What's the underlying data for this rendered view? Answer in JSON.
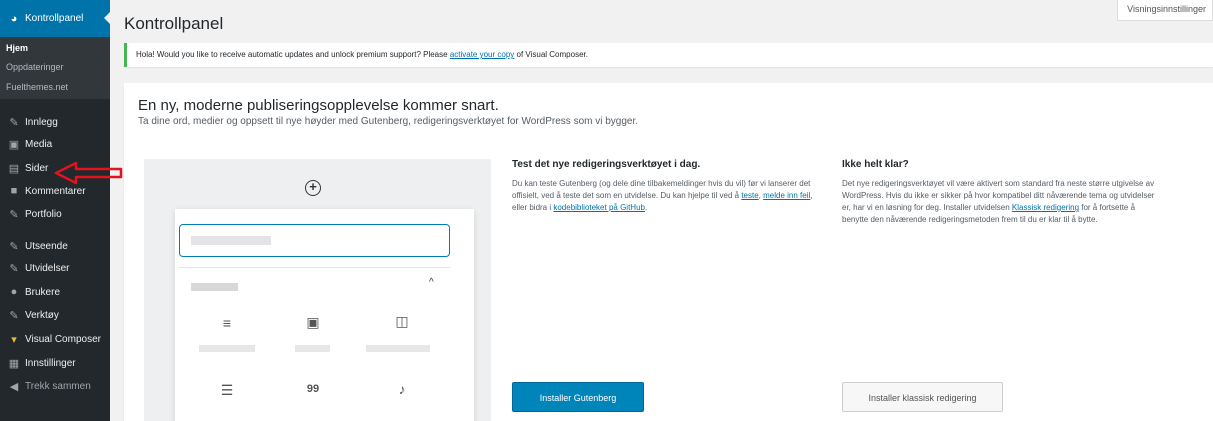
{
  "sidebar": {
    "dashboard": "Kontrollpanel",
    "sub_items": [
      "Hjem",
      "Oppdateringer",
      "Fuelthemes.net"
    ],
    "items": [
      {
        "label": "Innlegg",
        "icon": "✎"
      },
      {
        "label": "Media",
        "icon": "▣"
      },
      {
        "label": "Sider",
        "icon": "▤"
      },
      {
        "label": "Kommentarer",
        "icon": "■"
      },
      {
        "label": "Portfolio",
        "icon": "✎"
      },
      {
        "label": "Utseende",
        "icon": "✎"
      },
      {
        "label": "Utvidelser",
        "icon": "✎"
      },
      {
        "label": "Brukere",
        "icon": "●"
      },
      {
        "label": "Verktøy",
        "icon": "✎"
      },
      {
        "label": "Visual Composer",
        "icon": "▾"
      },
      {
        "label": "Innstillinger",
        "icon": "▦"
      }
    ],
    "collapse": "Trekk sammen",
    "dashboard_icon": "◕",
    "collapse_icon": "◀"
  },
  "header": {
    "title": "Kontrollpanel",
    "screen_options": "Visningsinnstillinger"
  },
  "notice": {
    "text_before": "Hola! Would you like to receive automatic updates and unlock premium support? Please ",
    "link": "activate your copy",
    "text_after": " of Visual Composer."
  },
  "welcome": {
    "title": "En ny, moderne publiseringsopplevelse kommer snart.",
    "subtitle": "Ta dine ord, medier og oppsett til nye høyder med Gutenberg, redigeringsverktøyet for WordPress som vi bygger.",
    "mockup_icons": {
      "add": "+",
      "chevron": "^",
      "paragraph": "≡",
      "image": "▣",
      "gallery": "◫",
      "list": "☰",
      "quote": "99",
      "audio": "♪"
    },
    "test": {
      "title": "Test det nye redigeringsverktøyet i dag.",
      "text": "Du kan teste Gutenberg (og dele dine tilbakemeldinger hvis du vil) før vi lanserer det offisielt, ved å teste det som en utvidelse. Du kan hjelpe til ved å ",
      "link1": "teste",
      "sep1": ", ",
      "link2": "melde inn feil",
      "text2": ", eller bidra i ",
      "link3": "kodebiblioteket på GitHub",
      "text3": ".",
      "button": "Installer Gutenberg"
    },
    "classic": {
      "title": "Ikke helt klar?",
      "text": "Det nye redigeringsverktøyet vil være aktivert som standard fra neste større utgivelse av WordPress. Hvis du ikke er sikker på hvor kompatibel ditt nåværende tema og utvidelser er, har vi en løsning for deg. Installer utvidelsen ",
      "link": "Klassisk redigering",
      "text2": " for å fortsette å benytte den nåværende redigeringsmetoden frem til du er klar til å bytte.",
      "button": "Installer klassisk redigering"
    }
  },
  "colors": {
    "sidebar_bg": "#23282d",
    "active_blue": "#0073aa",
    "button_blue": "#0085ba",
    "notice_green": "#46b450",
    "annotation_red": "#e0141e"
  }
}
